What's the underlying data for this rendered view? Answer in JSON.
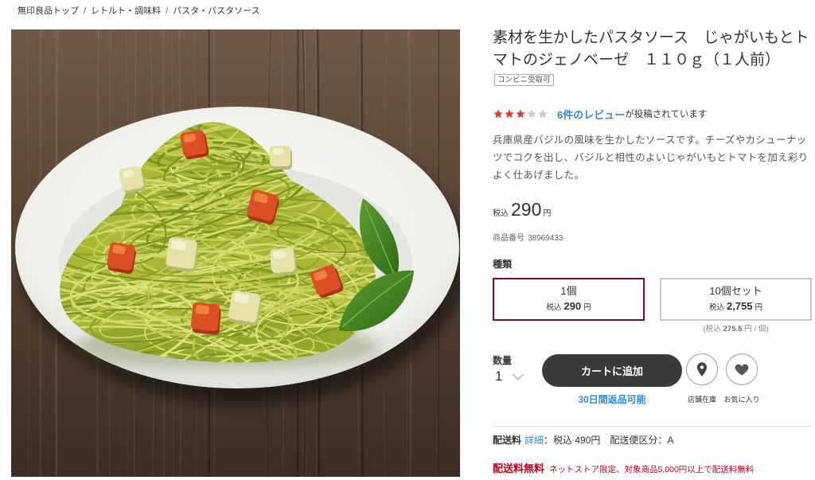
{
  "breadcrumb": {
    "separator": "/",
    "items": [
      "無印良品トップ",
      "レトルト・調味料",
      "パスタ・パスタソース"
    ]
  },
  "product": {
    "title": "素材を生かしたパスタソース　じゃがいもとトマトのジェノベーゼ　１１０ｇ（１人前）",
    "badge": "コンビニ受取可",
    "rating": {
      "value": 3,
      "max": 5,
      "star_icon": "star-icon"
    },
    "reviews_link": "6件のレビュー",
    "reviews_suffix": "が投稿されています",
    "description": "兵庫県産バジルの風味を生かしたソースです。チーズやカシューナッツでコクを出し、バジルと相性のよいじゃがいもとトマトを加え彩りよく仕あげました。",
    "price": {
      "prefix": "税込",
      "amount": "290",
      "unit": "円"
    },
    "item_number": {
      "label": "商品番号",
      "value": "38969433"
    }
  },
  "variants": {
    "label": "種類",
    "selected_index": 0,
    "options": [
      {
        "name": "1個",
        "price_prefix": "税込",
        "price": "290",
        "unit": "円"
      },
      {
        "name": "10個セット",
        "price_prefix": "税込",
        "price": "2,755",
        "unit": "円",
        "per_unit": {
          "prefix": "(税込",
          "value": "275.5",
          "suffix": "円 / 個)"
        }
      }
    ]
  },
  "purchase": {
    "quantity_label": "数量",
    "quantity_value": "1",
    "quantity_icon": "chevron-down-icon",
    "add_to_cart": "カートに追加",
    "return_policy": "30日間返品可能",
    "store_stock": {
      "label": "店舗在庫",
      "icon": "location-pin-icon"
    },
    "favorite": {
      "label": "お気に入り",
      "icon": "heart-icon"
    }
  },
  "shipping": {
    "label": "配送料",
    "details_link": "詳細",
    "fee": "：税込 490円",
    "class": "配送便区分：A",
    "free_label": "配送料無料",
    "free_note": "ネットストア限定、対象商品5,000円以上で配送料無料"
  },
  "colors": {
    "selected_border": "#7d0a1e",
    "option_border": "#c8c8c8",
    "link_blue": "#2f8ad8",
    "star_filled": "#d9412a",
    "star_empty": "#cccccc",
    "cart_bg": "#3a3a3a",
    "free_red": "#c4001a"
  }
}
